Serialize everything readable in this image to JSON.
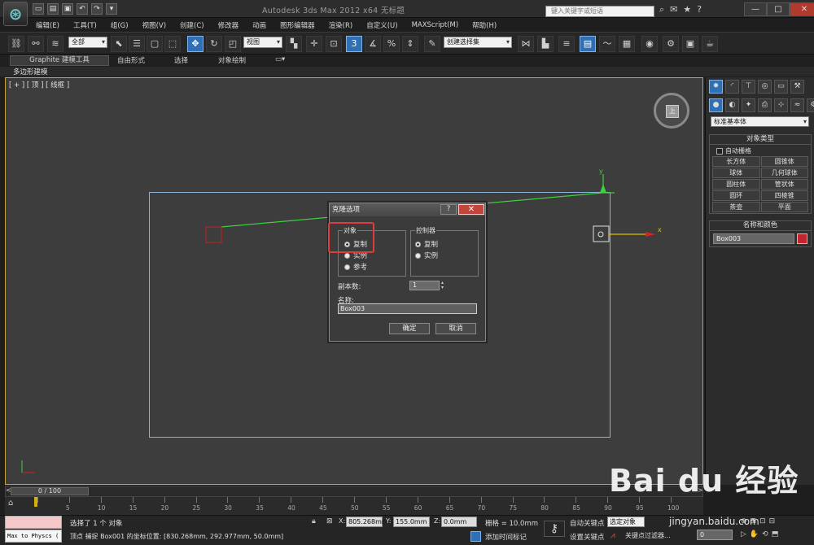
{
  "window": {
    "title": "Autodesk 3ds Max  2012 x64      无标题",
    "search_placeholder": "键入关键字或短语",
    "app_logo": "3ds-max-logo",
    "controls": [
      "—",
      "□",
      "✕"
    ]
  },
  "menu": [
    "编辑(E)",
    "工具(T)",
    "组(G)",
    "视图(V)",
    "创建(C)",
    "修改器",
    "动画",
    "图形编辑器",
    "渲染(R)",
    "自定义(U)",
    "MAXScript(M)",
    "帮助(H)"
  ],
  "toolbar": {
    "filter_select": "全部",
    "ref_coord_select": "视图",
    "named_sel_select": "创建选择集"
  },
  "ribbon": {
    "tabs": [
      "Graphite 建模工具",
      "自由形式",
      "选择",
      "对象绘制"
    ],
    "sub_label": "多边形建模"
  },
  "viewport": {
    "label": "[ + ] [ 顶 ] [ 线框 ]",
    "viewcube_face": "上",
    "axis_x": "x",
    "axis_y": "y"
  },
  "dialog": {
    "title": "克隆选项",
    "help_btn": "?",
    "close_btn": "✕",
    "object_group": "对象",
    "object_options": [
      "复制",
      "实例",
      "参考"
    ],
    "object_selected": "复制",
    "controller_group": "控制器",
    "controller_options": [
      "复制",
      "实例"
    ],
    "controller_selected": "复制",
    "copies_label": "副本数:",
    "copies_value": "1",
    "name_label": "名称:",
    "name_value": "Box003",
    "ok": "确定",
    "cancel": "取消"
  },
  "command_panel": {
    "category_select": "标准基本体",
    "object_type_header": "对象类型",
    "autogrid_label": "自动栅格",
    "objects": [
      "长方体",
      "圆锥体",
      "球体",
      "几何球体",
      "圆柱体",
      "管状体",
      "圆环",
      "四棱锥",
      "茶壶",
      "平面"
    ],
    "name_color_header": "名称和颜色",
    "name_value": "Box003",
    "object_color": "#c0262c"
  },
  "timeline": {
    "slider_text": "0 / 100",
    "ticks": [
      "0",
      "5",
      "10",
      "15",
      "20",
      "25",
      "30",
      "35",
      "40",
      "45",
      "50",
      "55",
      "60",
      "65",
      "70",
      "75",
      "80",
      "85",
      "90",
      "95",
      "100"
    ]
  },
  "status": {
    "maxscript_label": "Max to Physcs (",
    "selection_text": "选择了 1 个 对象",
    "prompt_text": "顶点 捕捉 Box001 的坐标位置:  [830.268mm, 292.977mm, 50.0mm]",
    "x_label": "X:",
    "x_value": "805.268mr",
    "y_label": "Y:",
    "y_value": "155.0mm",
    "z_label": "Z:",
    "z_value": "0.0mm",
    "grid_text": "栅格 = 10.0mm",
    "add_time_tag": "添加时间标记",
    "auto_key": "自动关键点",
    "set_key": "设置关键点",
    "selection_set": "选定对象",
    "key_filters": "关键点过滤器...",
    "frame_value": "0"
  },
  "watermark": {
    "brand": "Bai du 经验",
    "url": "jingyan.baidu.com"
  }
}
